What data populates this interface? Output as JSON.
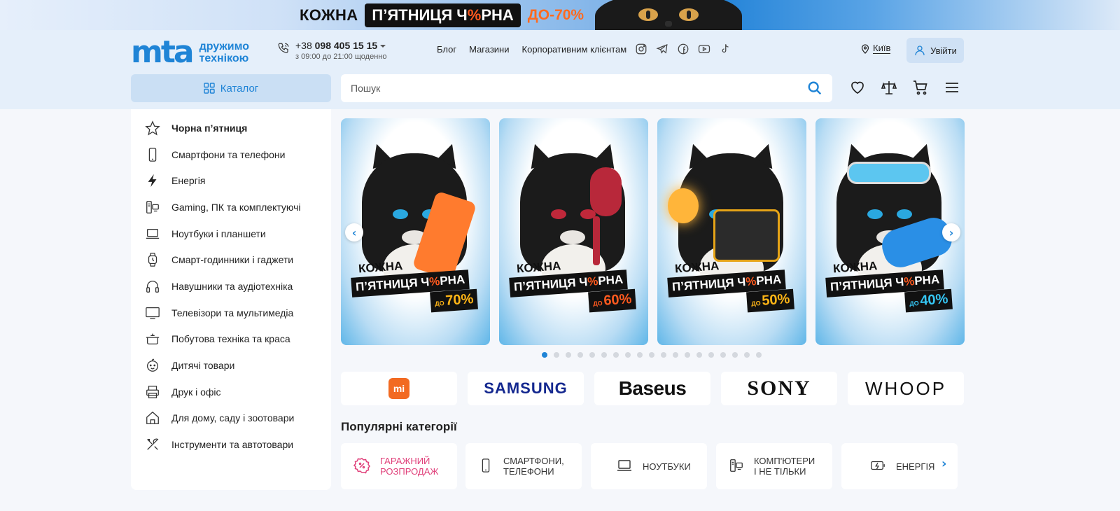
{
  "promo": {
    "word1": "КОЖНА",
    "black_part1": "П’ЯТНИЦЯ Ч",
    "black_pct": "%",
    "black_part2": "РНА",
    "discount": "ДО-70%"
  },
  "header": {
    "logo": "mta",
    "tagline": "дружимо технікою",
    "phone_prefix": "+38",
    "phone_number": "098 405 15 15",
    "phone_hours": "з 09:00 до 21:00 щоденно",
    "nav": [
      "Блог",
      "Магазини",
      "Корпоративним клієнтам"
    ],
    "social_icons": [
      "instagram-icon",
      "telegram-icon",
      "facebook-icon",
      "youtube-icon",
      "tiktok-icon"
    ],
    "city": "Київ",
    "login": "Увійти",
    "catalog": "Каталог",
    "search_placeholder": "Пошук"
  },
  "sidebar": {
    "items": [
      {
        "label": "Чорна п’ятниця",
        "icon": "star-icon"
      },
      {
        "label": "Смартфони та телефони",
        "icon": "smartphone-icon"
      },
      {
        "label": "Енергія",
        "icon": "lightning-icon"
      },
      {
        "label": "Gaming, ПК та комплектуючі",
        "icon": "pc-icon"
      },
      {
        "label": "Ноутбуки і планшети",
        "icon": "laptop-icon"
      },
      {
        "label": "Смарт-годинники і гаджети",
        "icon": "smartwatch-icon"
      },
      {
        "label": "Навушники та аудіотехніка",
        "icon": "headphones-icon"
      },
      {
        "label": "Телевізори та мультимедіа",
        "icon": "tv-icon"
      },
      {
        "label": "Побутова техніка та краса",
        "icon": "pot-icon"
      },
      {
        "label": "Дитячі товари",
        "icon": "baby-icon"
      },
      {
        "label": "Друк і офіс",
        "icon": "printer-icon"
      },
      {
        "label": "Для дому, саду і зоотовари",
        "icon": "home-icon"
      },
      {
        "label": "Інструменти та автотовари",
        "icon": "tools-icon"
      }
    ]
  },
  "banners": [
    {
      "word1": "КОЖНА",
      "black_part1": "П’ЯТНИЦЯ Ч",
      "black_pct": "%",
      "black_part2": "РНА",
      "do": "ДО",
      "discount": "70%",
      "prop": "orange-phone"
    },
    {
      "word1": "КОЖНА",
      "black_part1": "П’ЯТНИЦЯ Ч",
      "black_pct": "%",
      "black_part2": "РНА",
      "do": "ДО",
      "discount": "60%",
      "prop": "red-hairdryer"
    },
    {
      "word1": "КОЖНА",
      "black_part1": "П’ЯТНИЦЯ Ч",
      "black_pct": "%",
      "black_part2": "РНА",
      "do": "ДО",
      "discount": "50%",
      "prop": "power-station"
    },
    {
      "word1": "КОЖНА",
      "black_part1": "П’ЯТНИЦЯ Ч",
      "black_pct": "%",
      "black_part2": "РНА",
      "do": "ДО",
      "discount": "40%",
      "prop": "blue-gamepad"
    }
  ],
  "carousel": {
    "total_dots": 19,
    "active_dot": 1
  },
  "brands": [
    "mi",
    "SAMSUNG",
    "Baseus",
    "SONY",
    "WHOOP"
  ],
  "popular": {
    "title": "Популярні категорії",
    "items": [
      {
        "label": "Гаражний розпродаж",
        "icon": "percent-badge-icon"
      },
      {
        "label": "Смартфони, телефони",
        "icon": "smartphone-icon"
      },
      {
        "label": "Ноутбуки",
        "icon": "laptop-icon"
      },
      {
        "label": "Комп'ютери і не тільки",
        "icon": "pc-icon"
      },
      {
        "label": "Енергія",
        "icon": "battery-icon"
      }
    ]
  },
  "colors": {
    "accent": "#1f84d6",
    "header_bg": "#e5effa",
    "promo_orange": "#ff5a1f"
  }
}
